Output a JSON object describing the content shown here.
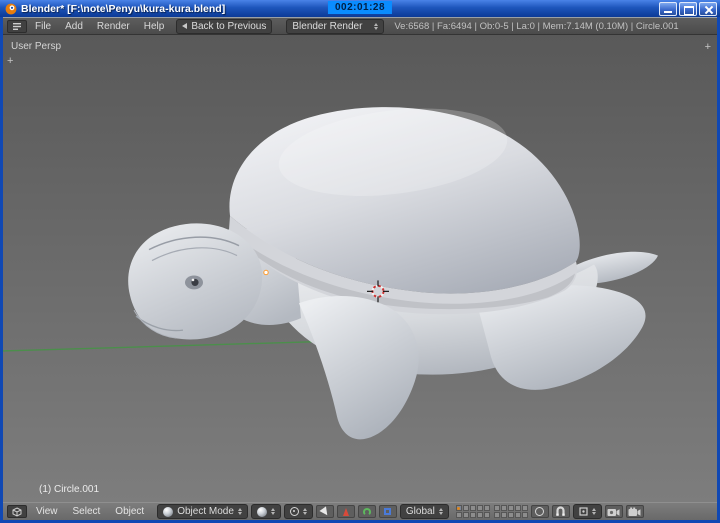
{
  "window": {
    "title": "Blender* [F:\\note\\Penyu\\kura-kura.blend]",
    "timer": "002:01:28"
  },
  "menubar": {
    "menus": [
      {
        "label": "File"
      },
      {
        "label": "Add"
      },
      {
        "label": "Render"
      },
      {
        "label": "Help"
      }
    ],
    "back_button": "Back to Previous",
    "engine": "Blender Render",
    "stats": "Ve:6568 | Fa:6494 | Ob:0-5 | La:0 | Mem:7.14M (0.10M) | Circle.001"
  },
  "viewport": {
    "view_label": "User Persp",
    "object_label": "(1) Circle.001",
    "plus_glyph": "+",
    "scene_object": "turtle model (Circle.001), smooth shaded, white-gray",
    "axis_line_color": "#4b8f4b",
    "cursor_color_ring": "#cc3333"
  },
  "footer": {
    "menus": [
      {
        "label": "View"
      },
      {
        "label": "Select"
      },
      {
        "label": "Object"
      }
    ],
    "mode": "Object Mode",
    "orientation": "Global",
    "layers": {
      "active_index": 0
    }
  },
  "icons": {
    "blender-logo-icon": "orange disc svg",
    "minimize-icon": "css bar",
    "maximize-icon": "css box",
    "close-icon": "css x",
    "info-editor-icon": "lines glyph",
    "back-arrow-icon": "css left triangle",
    "dropdown-updown-icon": "css twin triangles",
    "editor-type-3dview-icon": "cube svg",
    "object-mode-sphere-icon": "shaded sphere",
    "viewport-shading-icon": "shaded sphere",
    "pivot-point-icon": "circle with dot",
    "manipulator-pointer-icon": "white pointer",
    "translate-manipulator-icon": "red triangle",
    "rotate-manipulator-icon": "green arc",
    "scale-manipulator-icon": "blue square",
    "snap-magnet-icon": "horseshoe svg",
    "snap-element-icon": "small cube svg",
    "render-still-camera-icon": "camera svg",
    "render-animation-icon": "camera svg"
  }
}
